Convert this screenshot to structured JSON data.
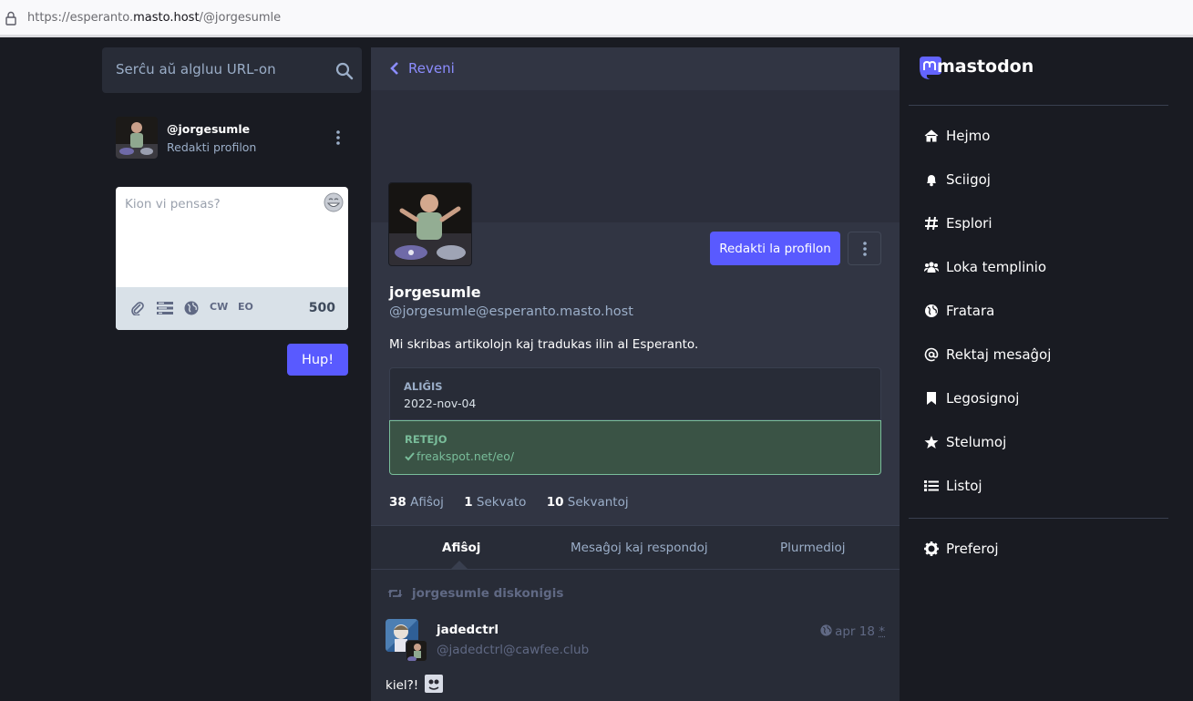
{
  "browser": {
    "url_prefix": "https://esperanto.",
    "url_domain": "masto.host",
    "url_path": "/@jorgesumle"
  },
  "search": {
    "placeholder": "Serĉu aŭ algluu URL-on"
  },
  "me": {
    "handle": "@jorgesumle",
    "edit_label": "Redakti profilon"
  },
  "compose": {
    "placeholder": "Kion vi pensas?",
    "cw_label": "CW",
    "lang_label": "EO",
    "char_count": "500",
    "submit_label": "Hup!"
  },
  "column": {
    "back_label": "Reveni"
  },
  "profile": {
    "edit_button": "Redakti la profilon",
    "display_name": "jorgesumle",
    "account": "@jorgesumle@esperanto.masto.host",
    "bio": "Mi skribas artikolojn kaj tradukas ilin al Esperanto.",
    "fields": [
      {
        "key": "ALIĜIS",
        "value": "2022-nov-04"
      },
      {
        "key": "RETEJO",
        "value": "freakspot.net/eo/"
      }
    ],
    "stats": [
      {
        "count": "38",
        "label": "Afiŝoj"
      },
      {
        "count": "1",
        "label": "Sekvato"
      },
      {
        "count": "10",
        "label": "Sekvantoj"
      }
    ]
  },
  "tabs": [
    {
      "label": "Afiŝoj"
    },
    {
      "label": "Mesaĝoj kaj respondoj"
    },
    {
      "label": "Plurmedioj"
    }
  ],
  "post": {
    "boost_text": "jorgesumle diskonigis",
    "author_name": "jadedctrl",
    "author_acct": "@jadedctrl@cawfee.club",
    "time": "apr 18",
    "edited_mark": "*",
    "text": "kiel?!"
  },
  "nav": {
    "logo_text": "mastodon",
    "items": [
      {
        "label": "Hejmo",
        "icon": "home-icon"
      },
      {
        "label": "Sciigoj",
        "icon": "bell-icon"
      },
      {
        "label": "Esplori",
        "icon": "hashtag-icon"
      },
      {
        "label": "Loka templinio",
        "icon": "users-icon"
      },
      {
        "label": "Fratara",
        "icon": "globe-icon"
      },
      {
        "label": "Rektaj mesaĝoj",
        "icon": "at-icon"
      },
      {
        "label": "Legosignoj",
        "icon": "bookmark-icon"
      },
      {
        "label": "Stelumoj",
        "icon": "star-icon"
      },
      {
        "label": "Listoj",
        "icon": "list-icon"
      }
    ],
    "preferences": {
      "label": "Preferoj",
      "icon": "gear-icon"
    }
  },
  "colors": {
    "accent": "#595aff",
    "background": "#191b22",
    "panel": "#282c37",
    "verified": "#79bd9a"
  }
}
